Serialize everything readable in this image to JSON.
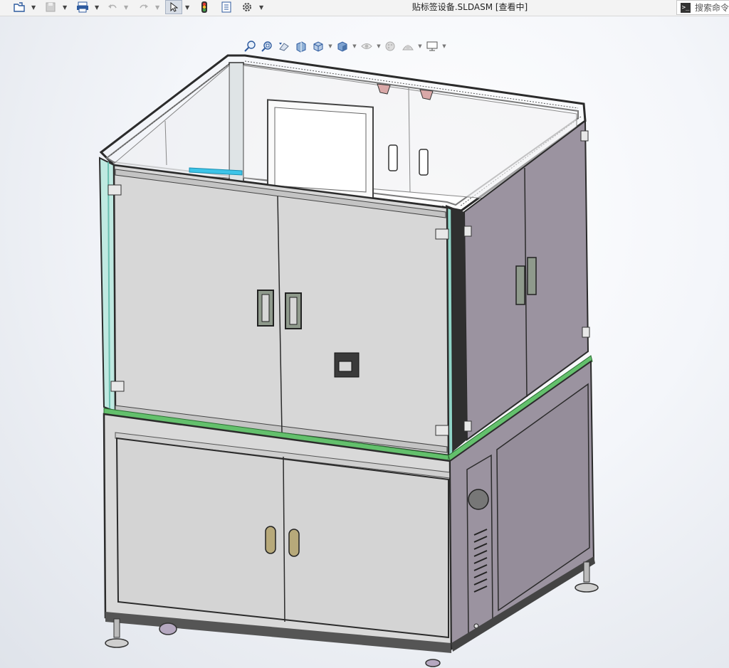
{
  "window": {
    "title": "贴标签设备.SLDASM [查看中]"
  },
  "toolbar": {
    "items": [
      {
        "name": "open-icon"
      },
      {
        "name": "save-icon"
      },
      {
        "name": "print-icon"
      },
      {
        "name": "undo-icon"
      },
      {
        "name": "redo-icon"
      },
      {
        "name": "select-icon"
      },
      {
        "name": "rebuild-icon"
      },
      {
        "name": "file-properties-icon"
      },
      {
        "name": "options-icon"
      }
    ]
  },
  "search": {
    "placeholder": "搜索命令",
    "icon": "command-prompt-icon"
  },
  "heads_up_toolbar": {
    "items": [
      "zoom-to-fit-icon",
      "zoom-to-area-icon",
      "previous-view-icon",
      "section-view-icon",
      "view-orientation-icon",
      "display-style-icon",
      "hide-show-items-icon",
      "edit-appearance-icon",
      "apply-scene-icon",
      "view-settings-icon"
    ]
  },
  "colors": {
    "viewport_bg": "#f4f6fa",
    "panel_gray": "#d6d6d6",
    "side_panel": "#9b93a0",
    "glass_edge": "#8fd4c7",
    "green_strip": "#63c06c",
    "frame_dark": "#2b2b2b"
  }
}
